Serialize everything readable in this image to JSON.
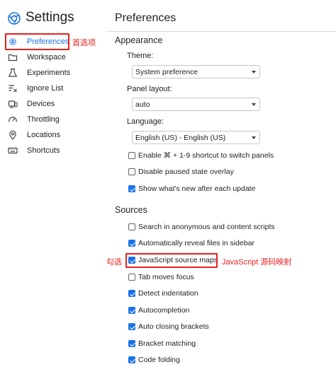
{
  "header": {
    "app_title": "Settings",
    "page_title": "Preferences"
  },
  "sidebar": {
    "items": [
      {
        "label": "Preferences",
        "icon": "gear-icon",
        "active": true
      },
      {
        "label": "Workspace",
        "icon": "folder-icon"
      },
      {
        "label": "Experiments",
        "icon": "flask-icon"
      },
      {
        "label": "Ignore List",
        "icon": "ignore-list-icon"
      },
      {
        "label": "Devices",
        "icon": "devices-icon"
      },
      {
        "label": "Throttling",
        "icon": "speedometer-icon"
      },
      {
        "label": "Locations",
        "icon": "location-pin-icon"
      },
      {
        "label": "Shortcuts",
        "icon": "keyboard-icon"
      }
    ]
  },
  "appearance": {
    "header": "Appearance",
    "theme": {
      "label": "Theme:",
      "value": "System preference"
    },
    "panel_layout": {
      "label": "Panel layout:",
      "value": "auto"
    },
    "language": {
      "label": "Language:",
      "value": "English (US) - English (US)"
    },
    "checkboxes": [
      {
        "label": "Enable ⌘ + 1-9 shortcut to switch panels",
        "checked": false
      },
      {
        "label": "Disable paused state overlay",
        "checked": false
      },
      {
        "label": "Show what's new after each update",
        "checked": true
      }
    ]
  },
  "sources": {
    "header": "Sources",
    "checkboxes": [
      {
        "label": "Search in anonymous and content scripts",
        "checked": false
      },
      {
        "label": "Automatically reveal files in sidebar",
        "checked": true
      },
      {
        "label": "JavaScript source maps",
        "checked": true
      },
      {
        "label": "Tab moves focus",
        "checked": false
      },
      {
        "label": "Detect indentation",
        "checked": true
      },
      {
        "label": "Autocompletion",
        "checked": true
      },
      {
        "label": "Auto closing brackets",
        "checked": true
      },
      {
        "label": "Bracket matching",
        "checked": true
      },
      {
        "label": "Code folding",
        "checked": true
      }
    ]
  },
  "annotations": {
    "preferences_note": "首选项",
    "checkbox_note": "勾选",
    "source_maps_note": "JavaScript 源码映射"
  },
  "colors": {
    "accent": "#1a73e8",
    "annotation_red": "#e8201f",
    "divider": "#dadce0"
  }
}
